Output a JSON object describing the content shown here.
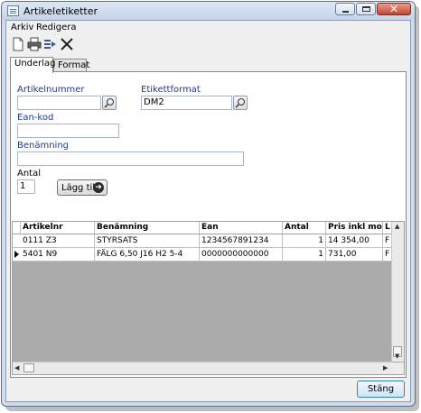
{
  "window": {
    "title": "Artikeletiketter"
  },
  "menu": {
    "items": [
      "Arkiv",
      "Redigera"
    ]
  },
  "toolbar": {
    "icons": [
      "new-document-icon",
      "print-icon",
      "export-icon",
      "delete-icon"
    ]
  },
  "tabs": [
    {
      "label": "Underlag",
      "active": true
    },
    {
      "label": "Format",
      "active": false
    }
  ],
  "form": {
    "artikelnummer": {
      "label": "Artikelnummer",
      "value": ""
    },
    "etikettformat": {
      "label": "Etikettformat",
      "value": "DM2"
    },
    "eankod": {
      "label": "Ean-kod",
      "value": ""
    },
    "benamning": {
      "label": "Benämning",
      "value": ""
    },
    "antal": {
      "label": "Antal",
      "value": "1"
    },
    "add_button": "Lägg till"
  },
  "grid": {
    "columns": [
      "Artikelnr",
      "Benämning",
      "Ean",
      "Antal",
      "Pris inkl moms",
      "L"
    ],
    "rows": [
      {
        "artikelnr": "0111 Z3",
        "benamning": "STYRSATS",
        "ean": "1234567891234",
        "antal": "1",
        "pris": "14 354,00",
        "l": "F",
        "selected": false
      },
      {
        "artikelnr": "5401 N9",
        "benamning": "FÄLG 6,50 J16 H2 5-4",
        "ean": "0000000000000",
        "antal": "1",
        "pris": "731,00",
        "l": "F",
        "selected": true
      }
    ]
  },
  "footer": {
    "close_label": "Stäng"
  },
  "colors": {
    "label_blue": "#1f3c8a",
    "title_bg": "#c4d4e8",
    "close_red": "#c4442c"
  }
}
